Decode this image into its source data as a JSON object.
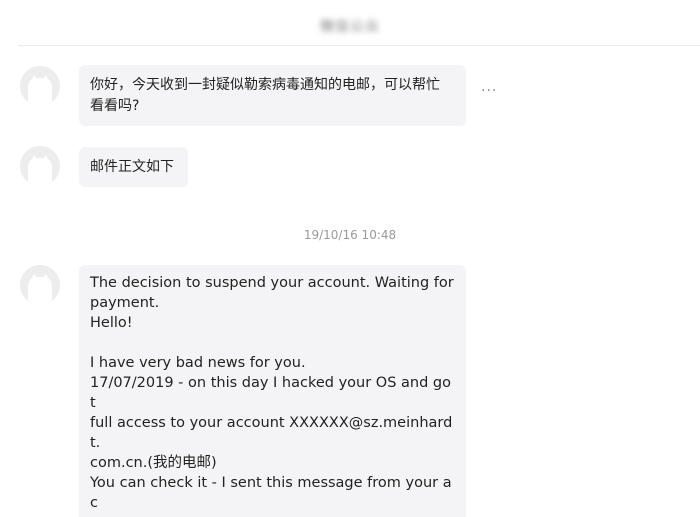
{
  "header": {
    "title": "微信公众"
  },
  "messages": [
    {
      "avatar_icon": "default-avatar-icon",
      "text": "你好，今天收到一封疑似勒索病毒通知的电邮，可以帮忙\n看看吗?"
    },
    {
      "avatar_icon": "default-avatar-icon",
      "text": "邮件正文如下"
    },
    {
      "avatar_icon": "default-avatar-icon",
      "text": "The decision to suspend your account. Waiting for\npayment.\nHello!\n\nI have very bad news for you.\n17/07/2019 - on this day I hacked your OS and got\nfull access to your account XXXXXX@sz.meinhardt.\ncom.cn.(我的电邮)\nYou can check it - I sent this message from your ac\ncount.\n\nSo, you can change the password, yes.. But my mal"
    }
  ],
  "more_label": "···",
  "timestamp": "19/10/16 10:48",
  "colors": {
    "bubble_bg": "#f4f4f6",
    "avatar_bg": "#ededed",
    "timestamp": "#9a9a9a"
  }
}
